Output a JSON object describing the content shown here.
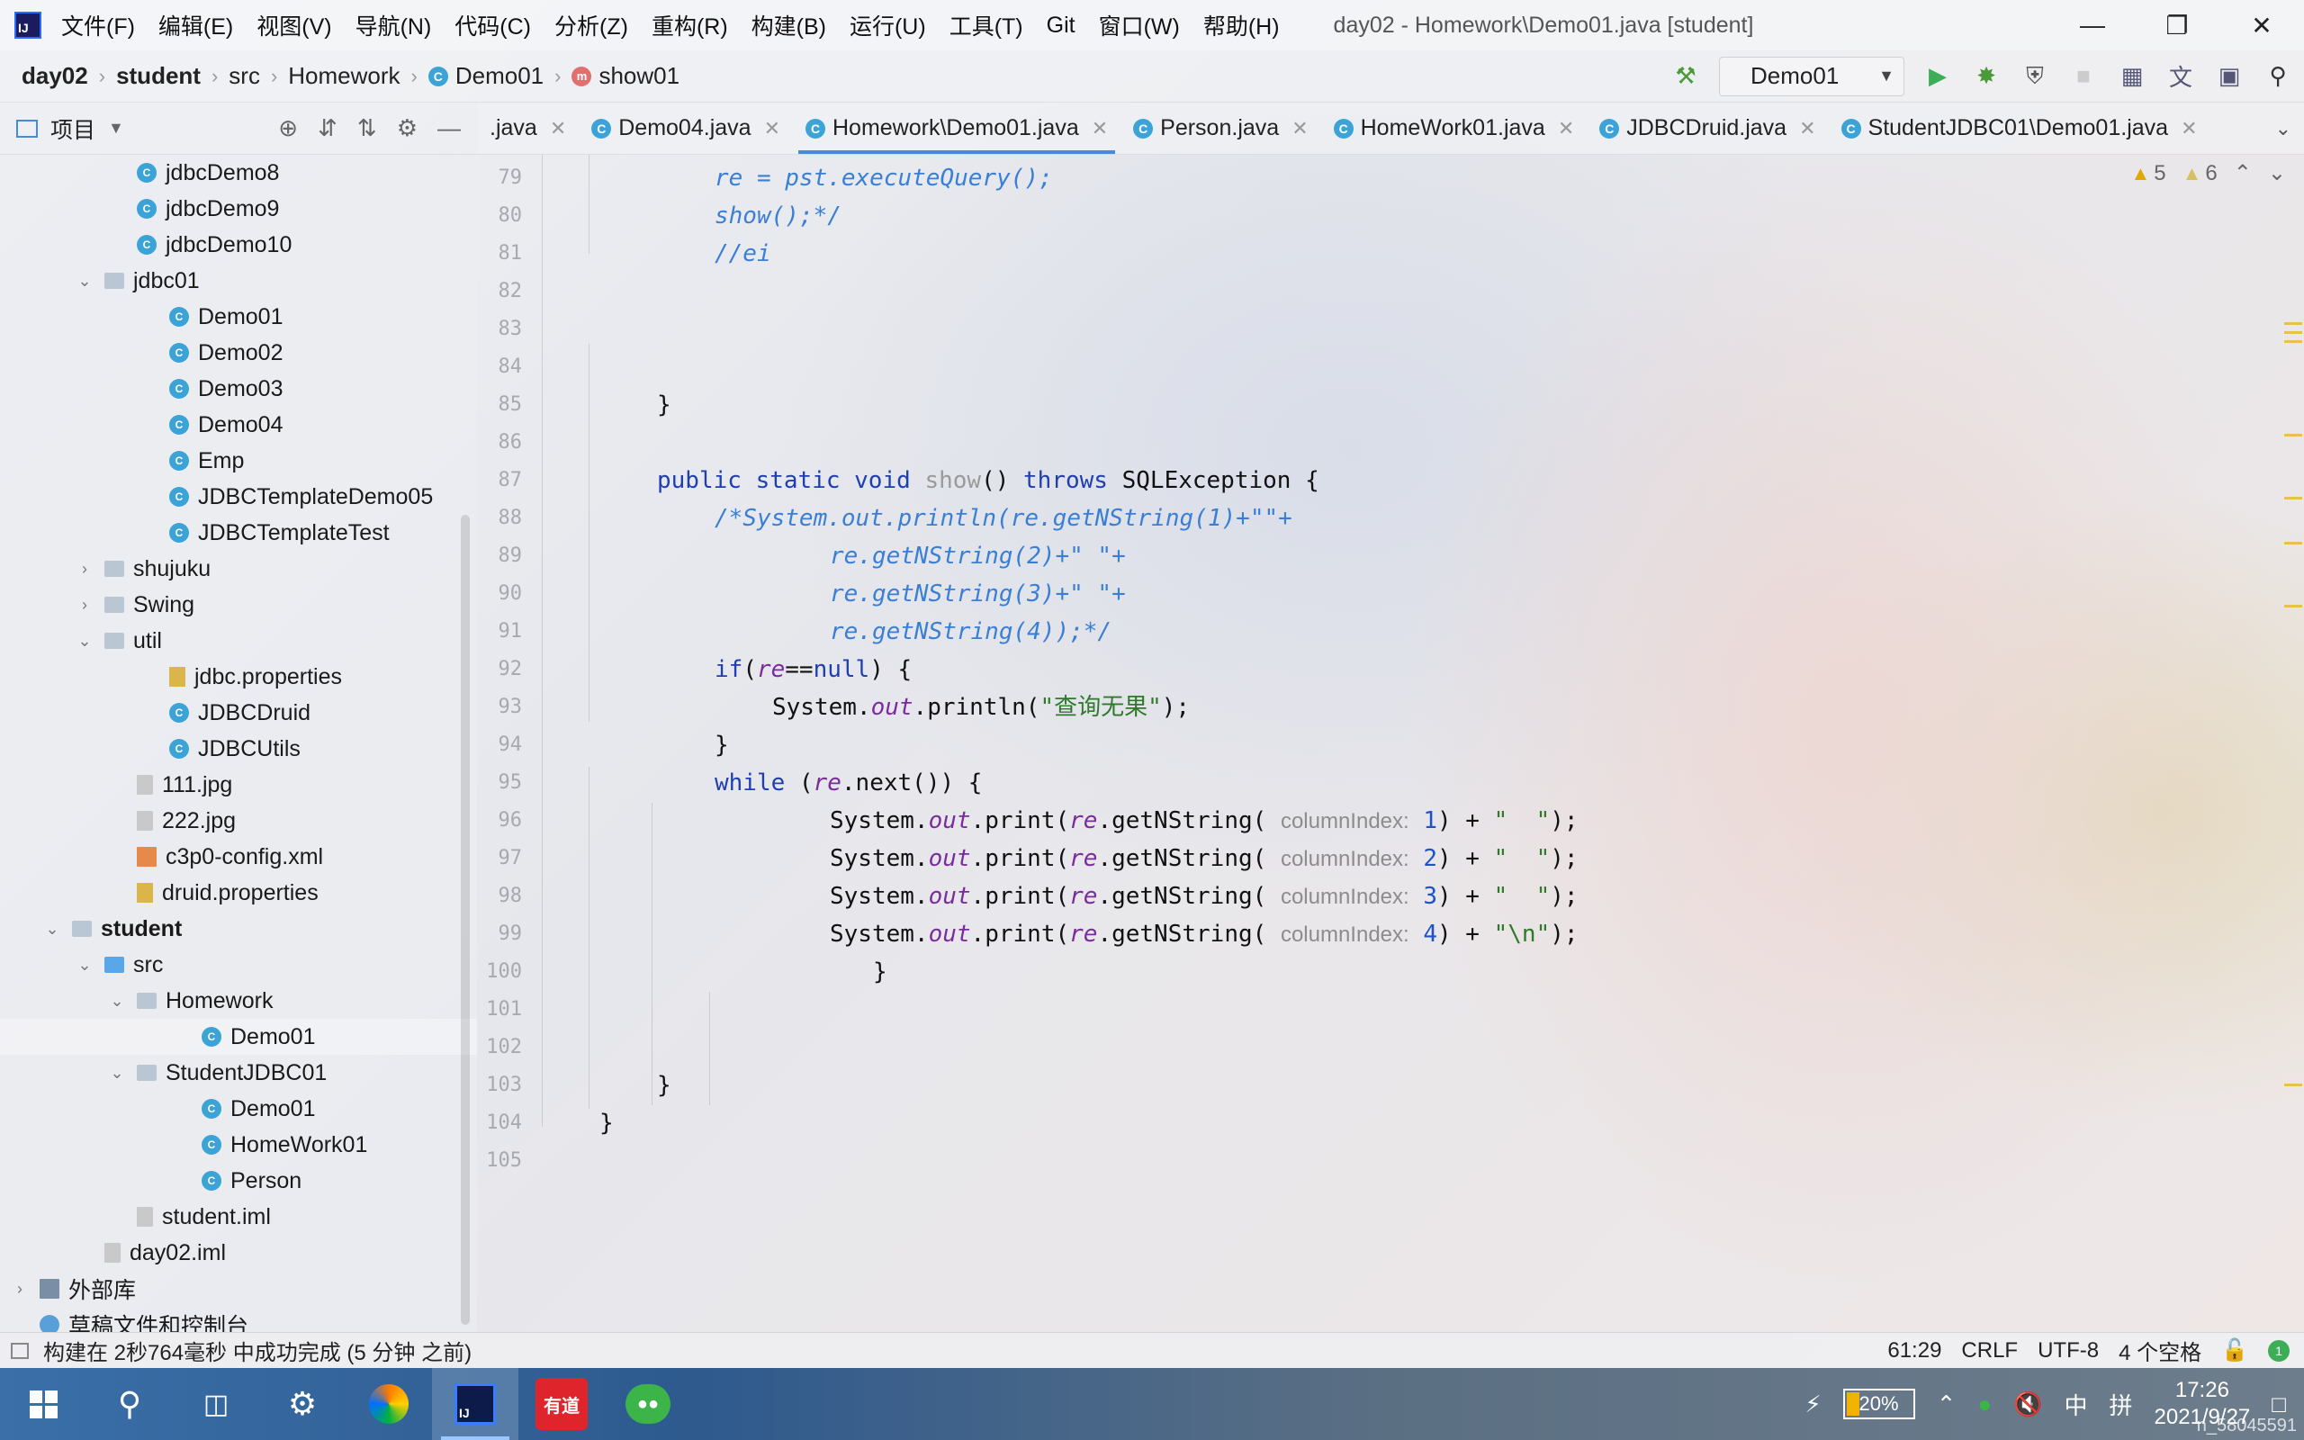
{
  "menu": {
    "items": [
      "文件(F)",
      "编辑(E)",
      "视图(V)",
      "导航(N)",
      "代码(C)",
      "分析(Z)",
      "重构(R)",
      "构建(B)",
      "运行(U)",
      "工具(T)",
      "Git",
      "窗口(W)",
      "帮助(H)"
    ],
    "window_title": "day02 - Homework\\Demo01.java [student]"
  },
  "breadcrumb": {
    "project": "day02",
    "module": "student",
    "src": "src",
    "package": "Homework",
    "class": "Demo01",
    "method": "show01"
  },
  "run_config": {
    "name": "Demo01"
  },
  "project_panel": {
    "title": "项目"
  },
  "tree": [
    {
      "label": "jdbcDemo8",
      "level": 4,
      "icon": "class"
    },
    {
      "label": "jdbcDemo9",
      "level": 4,
      "icon": "class"
    },
    {
      "label": "jdbcDemo10",
      "level": 4,
      "icon": "class"
    },
    {
      "label": "jdbc01",
      "level": 3,
      "icon": "folder",
      "toggle": "open"
    },
    {
      "label": "Demo01",
      "level": 5,
      "icon": "class"
    },
    {
      "label": "Demo02",
      "level": 5,
      "icon": "class"
    },
    {
      "label": "Demo03",
      "level": 5,
      "icon": "class"
    },
    {
      "label": "Demo04",
      "level": 5,
      "icon": "class"
    },
    {
      "label": "Emp",
      "level": 5,
      "icon": "class"
    },
    {
      "label": "JDBCTemplateDemo05",
      "level": 5,
      "icon": "class"
    },
    {
      "label": "JDBCTemplateTest",
      "level": 5,
      "icon": "class"
    },
    {
      "label": "shujuku",
      "level": 3,
      "icon": "folder",
      "toggle": "closed"
    },
    {
      "label": "Swing",
      "level": 3,
      "icon": "folder",
      "toggle": "closed"
    },
    {
      "label": "util",
      "level": 3,
      "icon": "folder",
      "toggle": "open"
    },
    {
      "label": "jdbc.properties",
      "level": 5,
      "icon": "props"
    },
    {
      "label": "JDBCDruid",
      "level": 5,
      "icon": "class"
    },
    {
      "label": "JDBCUtils",
      "level": 5,
      "icon": "class"
    },
    {
      "label": "111.jpg",
      "level": 4,
      "icon": "file"
    },
    {
      "label": "222.jpg",
      "level": 4,
      "icon": "file"
    },
    {
      "label": "c3p0-config.xml",
      "level": 4,
      "icon": "xml"
    },
    {
      "label": "druid.properties",
      "level": 4,
      "icon": "props"
    },
    {
      "label": "student",
      "level": 2,
      "icon": "folder",
      "toggle": "open",
      "bold": true
    },
    {
      "label": "src",
      "level": 3,
      "icon": "src",
      "toggle": "open"
    },
    {
      "label": "Homework",
      "level": 4,
      "icon": "folder",
      "toggle": "open"
    },
    {
      "label": "Demo01",
      "level": 6,
      "icon": "class",
      "selected": true
    },
    {
      "label": "StudentJDBC01",
      "level": 4,
      "icon": "folder",
      "toggle": "open"
    },
    {
      "label": "Demo01",
      "level": 6,
      "icon": "class"
    },
    {
      "label": "HomeWork01",
      "level": 6,
      "icon": "class"
    },
    {
      "label": "Person",
      "level": 6,
      "icon": "class"
    },
    {
      "label": "student.iml",
      "level": 4,
      "icon": "file"
    },
    {
      "label": "day02.iml",
      "level": 3,
      "icon": "file"
    },
    {
      "label": "外部库",
      "level": 1,
      "icon": "lib",
      "toggle": "closed"
    },
    {
      "label": "草稿文件和控制台",
      "level": 1,
      "icon": "scratch"
    }
  ],
  "tabs": [
    {
      "label": ".java",
      "active": false
    },
    {
      "label": "Demo04.java",
      "active": false
    },
    {
      "label": "Homework\\Demo01.java",
      "active": true
    },
    {
      "label": "Person.java",
      "active": false
    },
    {
      "label": "HomeWork01.java",
      "active": false
    },
    {
      "label": "JDBCDruid.java",
      "active": false
    },
    {
      "label": "StudentJDBC01\\Demo01.java",
      "active": false
    }
  ],
  "inspections": {
    "warnings": "5",
    "weak_warnings": "6"
  },
  "code": {
    "line_numbers": [
      "79",
      "80",
      "81",
      "82",
      "83",
      "84",
      "85",
      "86",
      "87",
      "88",
      "89",
      "90",
      "91",
      "92",
      "93",
      "94",
      "95",
      "96",
      "97",
      "98",
      "99",
      "100",
      "101",
      "102",
      "103",
      "104",
      "105"
    ],
    "l79": "re = pst.executeQuery();",
    "l80": "show();*/",
    "l81": "//ei",
    "l85": "}",
    "l87_kw1": "public",
    "l87_kw2": "static",
    "l87_kw3": "void",
    "l87_fn": "show",
    "l87_paren": "()",
    "l87_throws": "throws",
    "l87_exc": "SQLException {",
    "l88": "/*System.out.println(re.getNString(1)+\"\"+",
    "l89": "re.getNString(2)+\" \"+",
    "l90": "re.getNString(3)+\" \"+",
    "l91": "re.getNString(4));*/",
    "l92_if": "if",
    "l92_open": "(",
    "l92_re": "re",
    "l92_eq": "==",
    "l92_null": "null",
    "l92_close": ") {",
    "l93_sys": "System.",
    "l93_out": "out",
    "l93_call": ".println(",
    "l93_str": "\"查询无果\"",
    "l93_end": ");",
    "l94": "}",
    "l95_while": "while",
    "l95_open": " (",
    "l95_re": "re",
    "l95_rest": ".next()) {",
    "print_sys": "System.",
    "print_out": "out",
    "print_call": ".print(",
    "print_re": "re",
    "print_get": ".getNString(",
    "hint_label": "columnIndex:",
    "plus": ") + ",
    "str_space": "\"  \"",
    "str_newline": "\"\\n\"",
    "end": ");",
    "idx1": "1",
    "idx2": "2",
    "idx3": "3",
    "idx4": "4",
    "l100": "}",
    "l103": "}",
    "l104": "}"
  },
  "status": {
    "message": "构建在 2秒764毫秒 中成功完成 (5 分钟 之前)",
    "position": "61:29",
    "line_sep": "CRLF",
    "encoding": "UTF-8",
    "indent": "4 个空格"
  },
  "taskbar": {
    "battery": "20%",
    "ime_lang": "中",
    "ime_mode": "拼",
    "youdao_label": "有道",
    "time": "17:26",
    "date": "2021/9/27",
    "watermark": "n_58045591"
  }
}
